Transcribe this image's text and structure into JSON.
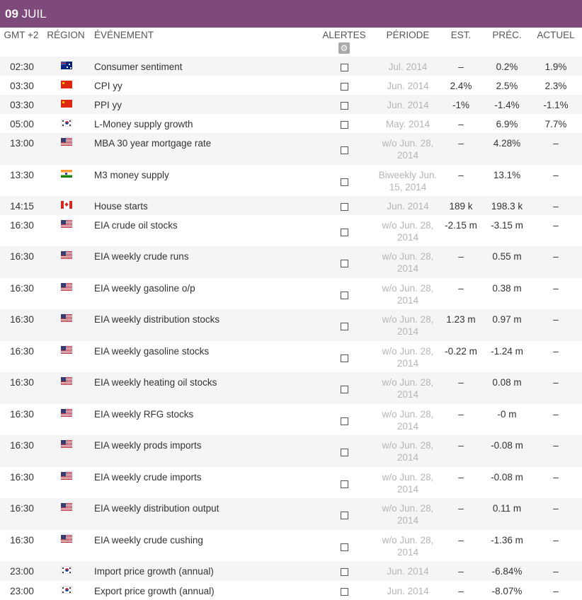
{
  "date": {
    "day": "09",
    "month": "JUIL"
  },
  "columns": {
    "time": "GMT +2",
    "region": "RÉGION",
    "event": "ÉVÉNEMENT",
    "alerts": "ALERTES",
    "period": "PÉRIODE",
    "est": "EST.",
    "prec": "PRÉC.",
    "actual": "ACTUEL"
  },
  "rows": [
    {
      "time": "02:30",
      "flag": "au",
      "event": "Consumer sentiment",
      "period": "Jul. 2014",
      "est": "–",
      "prec": "0.2%",
      "actual": "1.9%"
    },
    {
      "time": "03:30",
      "flag": "cn",
      "event": "CPI yy",
      "period": "Jun. 2014",
      "est": "2.4%",
      "prec": "2.5%",
      "actual": "2.3%"
    },
    {
      "time": "03:30",
      "flag": "cn",
      "event": "PPI yy",
      "period": "Jun. 2014",
      "est": "-1%",
      "prec": "-1.4%",
      "actual": "-1.1%"
    },
    {
      "time": "05:00",
      "flag": "kr",
      "event": "L-Money supply growth",
      "period": "May. 2014",
      "est": "–",
      "prec": "6.9%",
      "actual": "7.7%"
    },
    {
      "time": "13:00",
      "flag": "us",
      "event": "MBA 30 year mortgage rate",
      "period": "w/o Jun. 28, 2014",
      "est": "–",
      "prec": "4.28%",
      "actual": "–"
    },
    {
      "time": "13:30",
      "flag": "in",
      "event": "M3 money supply",
      "period": "Biweekly Jun. 15, 2014",
      "est": "–",
      "prec": "13.1%",
      "actual": "–"
    },
    {
      "time": "14:15",
      "flag": "ca",
      "event": "House starts",
      "period": "Jun. 2014",
      "est": "189 k",
      "prec": "198.3 k",
      "actual": "–"
    },
    {
      "time": "16:30",
      "flag": "us",
      "event": "EIA crude oil stocks",
      "period": "w/o Jun. 28, 2014",
      "est": "-2.15 m",
      "prec": "-3.15 m",
      "actual": "–"
    },
    {
      "time": "16:30",
      "flag": "us",
      "event": "EIA weekly crude runs",
      "period": "w/o Jun. 28, 2014",
      "est": "–",
      "prec": "0.55 m",
      "actual": "–"
    },
    {
      "time": "16:30",
      "flag": "us",
      "event": "EIA weekly gasoline o/p",
      "period": "w/o Jun. 28, 2014",
      "est": "–",
      "prec": "0.38 m",
      "actual": "–"
    },
    {
      "time": "16:30",
      "flag": "us",
      "event": "EIA weekly distribution stocks",
      "period": "w/o Jun. 28, 2014",
      "est": "1.23 m",
      "prec": "0.97 m",
      "actual": "–"
    },
    {
      "time": "16:30",
      "flag": "us",
      "event": "EIA weekly gasoline stocks",
      "period": "w/o Jun. 28, 2014",
      "est": "-0.22 m",
      "prec": "-1.24 m",
      "actual": "–"
    },
    {
      "time": "16:30",
      "flag": "us",
      "event": "EIA weekly heating oil stocks",
      "period": "w/o Jun. 28, 2014",
      "est": "–",
      "prec": "0.08 m",
      "actual": "–"
    },
    {
      "time": "16:30",
      "flag": "us",
      "event": "EIA weekly RFG stocks",
      "period": "w/o Jun. 28, 2014",
      "est": "–",
      "prec": "-0 m",
      "actual": "–"
    },
    {
      "time": "16:30",
      "flag": "us",
      "event": "EIA weekly prods imports",
      "period": "w/o Jun. 28, 2014",
      "est": "–",
      "prec": "-0.08 m",
      "actual": "–"
    },
    {
      "time": "16:30",
      "flag": "us",
      "event": "EIA weekly crude imports",
      "period": "w/o Jun. 28, 2014",
      "est": "–",
      "prec": "-0.08 m",
      "actual": "–"
    },
    {
      "time": "16:30",
      "flag": "us",
      "event": "EIA weekly distribution output",
      "period": "w/o Jun. 28, 2014",
      "est": "–",
      "prec": "0.11 m",
      "actual": "–"
    },
    {
      "time": "16:30",
      "flag": "us",
      "event": "EIA weekly crude cushing",
      "period": "w/o Jun. 28, 2014",
      "est": "–",
      "prec": "-1.36 m",
      "actual": "–"
    },
    {
      "time": "23:00",
      "flag": "kr",
      "event": "Import price growth (annual)",
      "period": "Jun. 2014",
      "est": "–",
      "prec": "-6.84%",
      "actual": "–"
    },
    {
      "time": "23:00",
      "flag": "kr",
      "event": "Export price growth (annual)",
      "period": "Jun. 2014",
      "est": "–",
      "prec": "-8.07%",
      "actual": "–"
    }
  ]
}
